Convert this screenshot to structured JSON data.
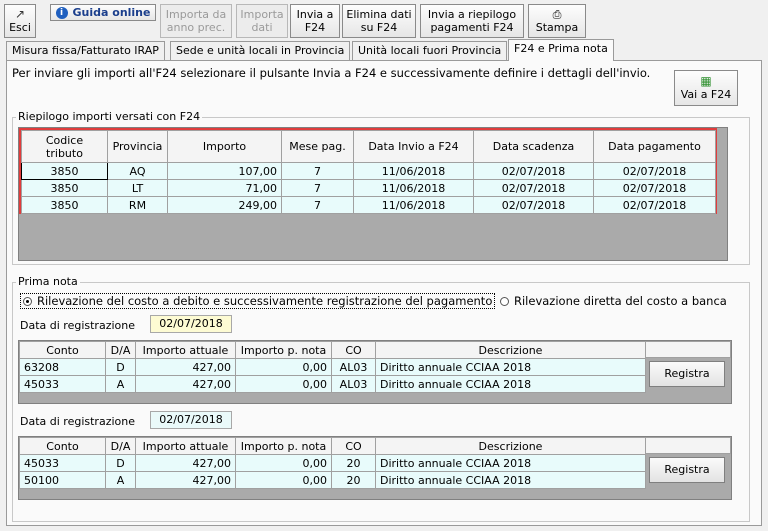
{
  "toolbar": {
    "esci": "Esci",
    "guida": "Guida online",
    "importa_line1": "Importa da",
    "importa_line2": "anno prec.",
    "importa_dati_line1": "Importa",
    "importa_dati_line2": "dati",
    "invia_line1": "Invia a",
    "invia_line2": "F24",
    "elimina_line1": "Elimina dati",
    "elimina_line2": "su F24",
    "riepilogo_line1": "Invia a riepilogo",
    "riepilogo_line2": "pagamenti F24",
    "stampa": "Stampa"
  },
  "tabs": [
    {
      "label": "Misura fissa/Fatturato IRAP"
    },
    {
      "label": "Sede e unità locali in Provincia"
    },
    {
      "label": "Unità locali fuori Provincia"
    },
    {
      "label": "F24 e Prima nota"
    }
  ],
  "info_text": "Per inviare gli importi all'F24 selezionare il pulsante Invia a F24 e successivamente definire i dettagli dell'invio.",
  "vai_button": "Vai a F24",
  "riepilogo": {
    "title": "Riepilogo importi versati con F24",
    "headers": [
      "Codice tributo",
      "Provincia",
      "Importo",
      "Mese pag.",
      "Data Invio a F24",
      "Data scadenza",
      "Data pagamento"
    ],
    "header_codice_line1": "Codice",
    "header_codice_line2": "tributo",
    "rows": [
      {
        "codice": "3850",
        "provincia": "AQ",
        "importo": "107,00",
        "mese": "7",
        "invio": "11/06/2018",
        "scadenza": "02/07/2018",
        "pagamento": "02/07/2018"
      },
      {
        "codice": "3850",
        "provincia": "LT",
        "importo": "71,00",
        "mese": "7",
        "invio": "11/06/2018",
        "scadenza": "02/07/2018",
        "pagamento": "02/07/2018"
      },
      {
        "codice": "3850",
        "provincia": "RM",
        "importo": "249,00",
        "mese": "7",
        "invio": "11/06/2018",
        "scadenza": "02/07/2018",
        "pagamento": "02/07/2018"
      }
    ]
  },
  "prima_nota": {
    "title": "Prima nota",
    "radio1": "Rilevazione del costo a debito e successivamente registrazione del pagamento",
    "radio2": "Rilevazione diretta del costo a banca",
    "data_label": "Data di registrazione",
    "headers": [
      "Conto",
      "D/A",
      "Importo attuale",
      "Importo p. nota",
      "CO",
      "Descrizione"
    ],
    "block1": {
      "date": "02/07/2018",
      "rows": [
        {
          "conto": "63208",
          "da": "D",
          "attuale": "427,00",
          "pnota": "0,00",
          "co": "AL03",
          "descr": "Diritto annuale CCIAA 2018"
        },
        {
          "conto": "45033",
          "da": "A",
          "attuale": "427,00",
          "pnota": "0,00",
          "co": "AL03",
          "descr": "Diritto annuale CCIAA 2018"
        }
      ]
    },
    "block2": {
      "date": "02/07/2018",
      "rows": [
        {
          "conto": "45033",
          "da": "D",
          "attuale": "427,00",
          "pnota": "0,00",
          "co": "20",
          "descr": "Diritto annuale CCIAA 2018"
        },
        {
          "conto": "50100",
          "da": "A",
          "attuale": "427,00",
          "pnota": "0,00",
          "co": "20",
          "descr": "Diritto annuale CCIAA 2018"
        }
      ]
    },
    "registra": "Registra"
  },
  "colors": {
    "highlight_border": "#e03c3c",
    "row_bg": "#e8fbfb",
    "date_bg1": "#fdfbd3",
    "date_bg2": "#eafafa"
  }
}
